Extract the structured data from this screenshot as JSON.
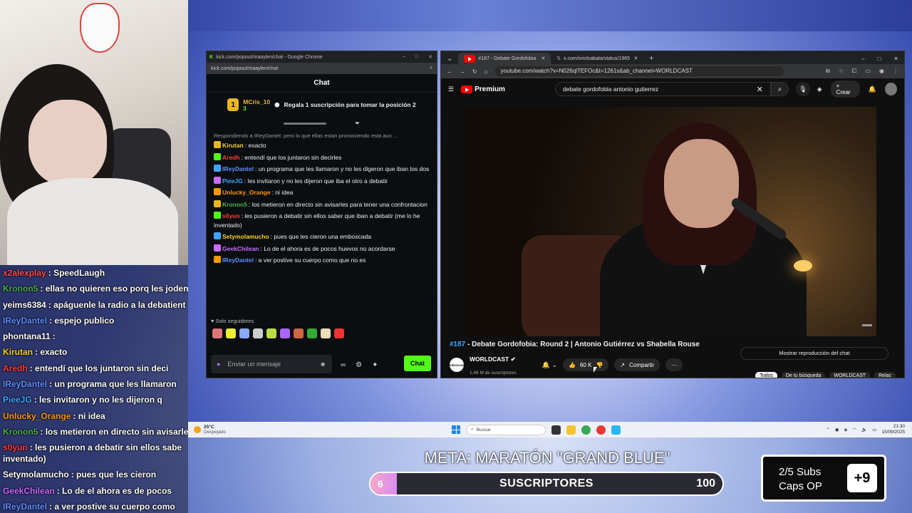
{
  "colors": {
    "kick_green": "#53fc18",
    "yt_red": "#ff0000",
    "link_blue": "#3ea6ff"
  },
  "overlay_chat": [
    {
      "user": "x2alexplay",
      "color": "#ff4d4d",
      "text": "SpeedLaugh"
    },
    {
      "user": "Kronon5",
      "color": "#4caf50",
      "text": "ellas no quieren eso porq les joden"
    },
    {
      "user": "yeims6384",
      "color": "#ffffff",
      "text": "apáguenle la radio a la debatient"
    },
    {
      "user": "IReyDantel",
      "color": "#5f8cff",
      "text": "espejo publico"
    },
    {
      "user": "phontana11",
      "color": "#ffffff",
      "text": ""
    },
    {
      "user": "Kirutan",
      "color": "#f5d21b",
      "text": "exacto"
    },
    {
      "user": "Aredh",
      "color": "#ff3b3b",
      "text": "entendí que los juntaron sin deci"
    },
    {
      "user": "IReyDantel",
      "color": "#5f8cff",
      "text": "un programa que les llamaron"
    },
    {
      "user": "PieeJG",
      "color": "#3ea6ff",
      "text": "les invitaron y no les dijeron q"
    },
    {
      "user": "Unlucky_Orange",
      "color": "#ff9800",
      "text": "ni idea"
    },
    {
      "user": "Kronon5",
      "color": "#4caf50",
      "text": "los metieron en directo sin avisarle"
    },
    {
      "user": "s0yun",
      "color": "#ff3b3b",
      "text": "les pusieron a debatir sin ellos sabe inventado)"
    },
    {
      "user": "Setymolamucho",
      "color": "#ffffff",
      "text": "pues que les cieron"
    },
    {
      "user": "GeekChilean",
      "color": "#c86bff",
      "text": "Lo de el ahora es de pocos"
    },
    {
      "user": "IReyDantel",
      "color": "#5f8cff",
      "text": "a ver postive su cuerpo como"
    }
  ],
  "chat_window": {
    "window_title": "kick.com/popout/maaylen/chat - Google Chrome",
    "url": "kick.com/popout/maaylen/chat",
    "header": "Chat",
    "pinned": {
      "user": "MCris_10",
      "count": "3",
      "text": "Regala 1 suscripción para tomar la posición 2"
    },
    "reply_preview": "Respondiendo a IReyDantel: pero lo que ellas estan promoviendo esta aun ...",
    "messages": [
      {
        "user": "Kirutan",
        "color": "#f5d21b",
        "text": "exacto"
      },
      {
        "user": "Aredh",
        "color": "#ff3b3b",
        "text": "entendí que los juntaron sin decirles"
      },
      {
        "user": "IReyDantel",
        "color": "#5f8cff",
        "text": "un programa que les llamaron y no les digeron que iban los dos"
      },
      {
        "user": "PieeJG",
        "color": "#3ea6ff",
        "text": "les invitaron y no les dijeron que iba el otro a debatir"
      },
      {
        "user": "Unlucky_Orange",
        "color": "#ff9800",
        "text": "ni idea"
      },
      {
        "user": "Kronon5",
        "color": "#4caf50",
        "text": "los metieron en directo sin avisarles para tener una confrontacion"
      },
      {
        "user": "s0yun",
        "color": "#ff3b3b",
        "text": "les pusieron a debatir sin ellos saber que iban a debatir (me lo he inventado)"
      },
      {
        "user": "Setymolamucho",
        "color": "#f5d21b",
        "text": "pues que les cieron una emboscada"
      },
      {
        "user": "GeekChilean",
        "color": "#c86bff",
        "text": "Lo de el ahora es de pocos huevos no acordarse"
      },
      {
        "user": "IReyDantel",
        "color": "#5f8cff",
        "text": "a ver postive su cuerpo como que no es"
      }
    ],
    "followers_only": "Solo seguidores",
    "input_placeholder": "Enviar un mensaje",
    "send_label": "Chat"
  },
  "yt_window": {
    "tab1": "#187 - Debate Gordofobia",
    "tab2": "x.com/oriolsabata/status/1965",
    "url": "youtube.com/watch?v=N026qlTEFOc&t=1261s&ab_channel=WORLDCAST",
    "brand": "Premium",
    "search_value": "debate gordofobia antonio gutierrez",
    "create_label": "Crear",
    "video_title_num": "#187",
    "video_title": "- Debate Gordofobia: Round 2 | Antonio Gutiérrez vs Shabella Rouse",
    "channel_name": "WORLDCAST",
    "channel_avatar_text": "WORLDCAST",
    "channel_subs": "1,46 M de suscriptores",
    "likes": "60 K",
    "share_label": "Compartir",
    "show_chat_label": "Mostrar reproducción del chat",
    "chips": [
      "Todos",
      "De tu búsqueda",
      "WORLDCAST",
      "Relac"
    ]
  },
  "taskbar": {
    "temp": "25°C",
    "weather": "Despejado",
    "search_label": "Buscar",
    "time": "21:30",
    "date": "15/09/2025"
  },
  "overlay": {
    "meta_title": "META: MARATÓN \"GRAND BLUE\"",
    "sub_current": "6",
    "sub_label": "SUSCRIPTORES",
    "sub_goal": "100",
    "sub_progress": 0.06,
    "caps_line1": "2/5 Subs",
    "caps_line2": "Caps OP",
    "caps_plus": "+9"
  }
}
